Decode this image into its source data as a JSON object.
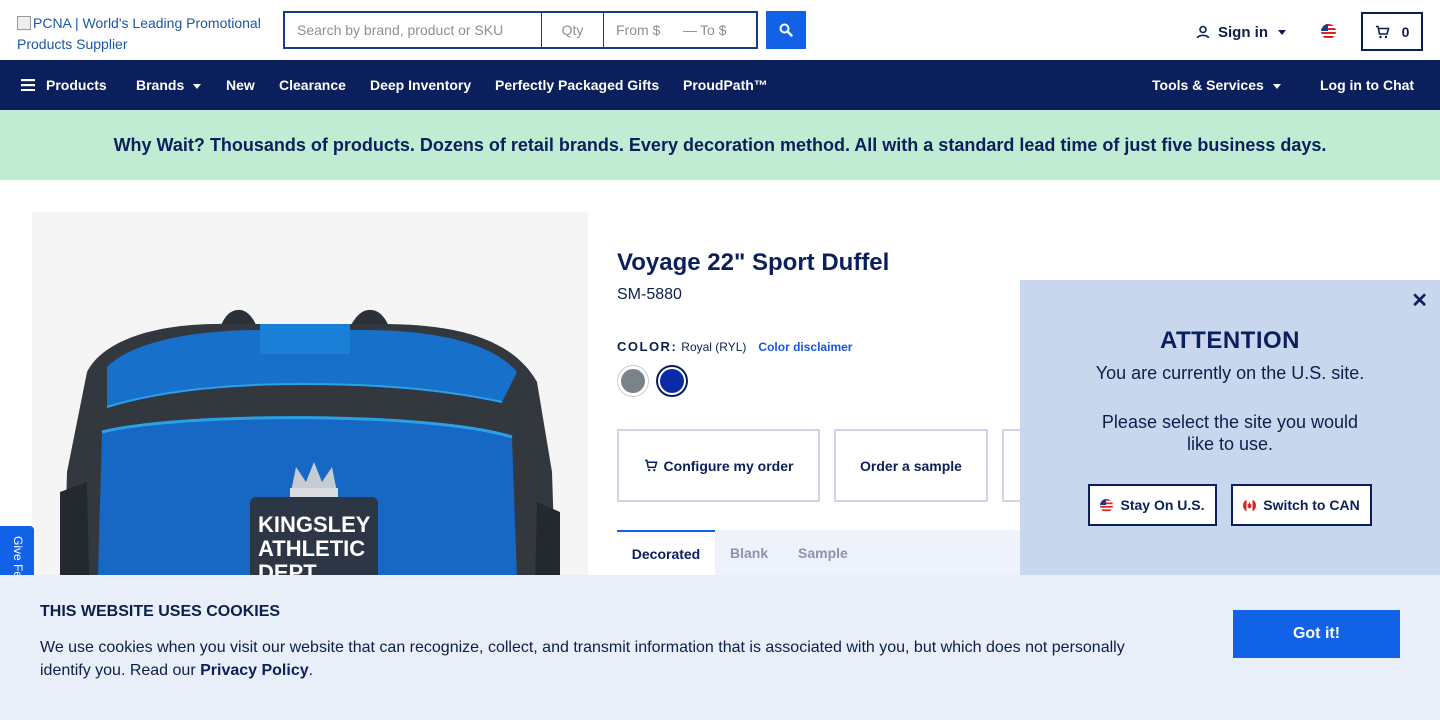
{
  "header": {
    "logo_alt": "PCNA | World's Leading Promotional Products Supplier",
    "search_placeholder": "Search by brand, product or SKU",
    "qty_placeholder": "Qty",
    "from_placeholder": "From $",
    "to_placeholder": "To $",
    "dash": "—",
    "signin_label": "Sign in",
    "cart_count": "0"
  },
  "nav": {
    "products": "Products",
    "brands": "Brands",
    "new": "New",
    "clearance": "Clearance",
    "deep_inventory": "Deep Inventory",
    "perfectly_packaged": "Perfectly Packaged Gifts",
    "proudpath": "ProudPath™",
    "tools": "Tools & Services",
    "chat": "Log in to Chat"
  },
  "promo": {
    "text": "Why Wait? Thousands of products. Dozens of retail brands. Every decoration method. All with a standard lead time of just five business days."
  },
  "product": {
    "title": "Voyage 22\" Sport Duffel",
    "sku": "SM-5880",
    "color_label": "COLOR:",
    "color_value": "Royal (RYL)",
    "color_disclaimer": "Color disclaimer",
    "swatches": [
      {
        "name": "Gray",
        "color": "#7a8387",
        "selected": false
      },
      {
        "name": "Royal",
        "color": "#0b2aa8",
        "selected": true
      }
    ],
    "image_text": {
      "line1": "KINGSLEY",
      "line2": "ATHLETIC",
      "line3": "DEPT"
    },
    "actions": {
      "configure": "Configure my order",
      "sample": "Order a sample"
    },
    "tabs": [
      "Decorated",
      "Blank",
      "Sample"
    ]
  },
  "feedback": {
    "label": "Give Feedback"
  },
  "attention": {
    "title": "ATTENTION",
    "line1": "You are currently on the U.S. site.",
    "line2": "Please select the site you would like to use.",
    "stay_label": "Stay On U.S.",
    "switch_label": "Switch to CAN"
  },
  "cookie": {
    "title": "THIS WEBSITE USES COOKIES",
    "text_before": "We use cookies when you visit our website that can recognize, collect, and transmit information that is associated with you, but which does not personally identify you. Read our ",
    "link": "Privacy Policy",
    "text_after": ".",
    "button": "Got it!"
  },
  "colors": {
    "navy": "#0b1f5c",
    "accent_blue": "#1162e6",
    "promo_green": "#c1ecd4",
    "modal_bg": "#c9d7ee",
    "cookie_bg": "#e9eff9"
  }
}
